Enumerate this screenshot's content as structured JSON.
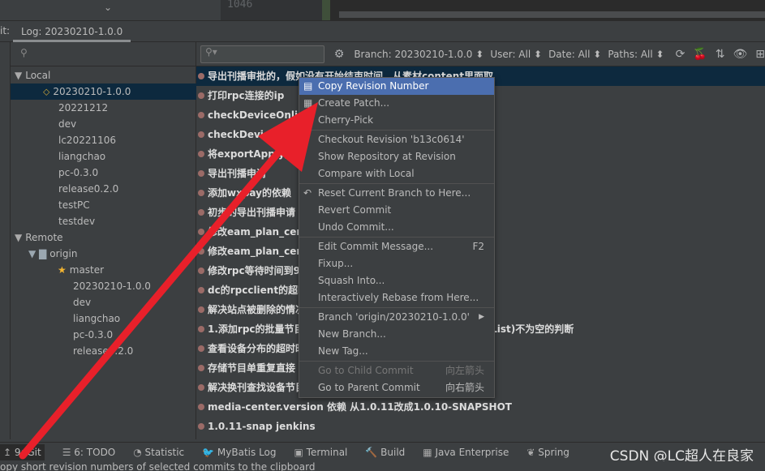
{
  "editor": {
    "line_number": "1046"
  },
  "tab": {
    "prefix": "it:",
    "label": "Log: 20230210-1.0.0"
  },
  "branches": {
    "local_label": "Local",
    "local": [
      "20230210-1.0.0",
      "20221212",
      "dev",
      "lc20221106",
      "liangchao",
      "pc-0.3.0",
      "release0.2.0",
      "testPC",
      "testdev"
    ],
    "remote_label": "Remote",
    "origin_label": "origin",
    "remote": [
      "master",
      "20230210-1.0.0",
      "dev",
      "liangchao",
      "pc-0.3.0",
      "release0.2.0"
    ]
  },
  "toolbar": {
    "branch": "Branch: 20230210-1.0.0 ⬍",
    "user": "User: All ⬍",
    "date": "Date: All ⬍",
    "paths": "Paths: All ⬍"
  },
  "commits": [
    "导出刊播审批的，假如没有开始结束时间，从素材content里面取",
    "打印rpc连接的ip",
    "checkDeviceOnline",
    "checkDeviceOnline",
    "将exportApply接口",
    "导出刊播申请",
    "添加wxpay的依赖",
    "初步的导出刊播申请",
    "修改eam_plan_cent",
    "修改eam_plan_cent",
    "修改rpc等待时间到9",
    "dc的rpcclient的超时",
    "解决站点被删除的情况",
    "1.添加rpc的批量节目 … 添加CollUtil.isNotEmpty(topInfoList)不为空的判断",
    "查看设备分布的超时时",
    "存储节目单重复直接",
    "解决换刊查找设备节目 … 判断了是否包含要替换的素材",
    "media-center.version 依赖 从1.0.11改成1.0.10-SNAPSHOT",
    "1.0.11-snap jenkins"
  ],
  "menu": {
    "groups": [
      [
        {
          "label": "Copy Revision Number",
          "icon": "copy-icon",
          "highlight": true
        },
        {
          "label": "Create Patch...",
          "icon": "patch-icon"
        },
        {
          "label": "Cherry-Pick"
        }
      ],
      [
        {
          "label": "Checkout Revision 'b13c0614'"
        },
        {
          "label": "Show Repository at Revision"
        },
        {
          "label": "Compare with Local"
        }
      ],
      [
        {
          "label": "Reset Current Branch to Here...",
          "icon": "undo-icon"
        },
        {
          "label": "Revert Commit"
        },
        {
          "label": "Undo Commit..."
        }
      ],
      [
        {
          "label": "Edit Commit Message...",
          "shortcut": "F2"
        },
        {
          "label": "Fixup..."
        },
        {
          "label": "Squash Into..."
        },
        {
          "label": "Interactively Rebase from Here..."
        }
      ],
      [
        {
          "label": "Branch 'origin/20230210-1.0.0'",
          "submenu": true
        },
        {
          "label": "New Branch..."
        },
        {
          "label": "New Tag..."
        }
      ],
      [
        {
          "label": "Go to Child Commit",
          "shortcut": "向左箭头",
          "disabled": true
        },
        {
          "label": "Go to Parent Commit",
          "shortcut": "向右箭头"
        }
      ]
    ]
  },
  "toolwindows": [
    {
      "label": "9: Git",
      "icon": "git-icon",
      "active": true
    },
    {
      "label": "6: TODO",
      "icon": "todo-icon"
    },
    {
      "label": "Statistic",
      "icon": "statistic-icon"
    },
    {
      "label": "MyBatis Log",
      "icon": "mybatis-icon"
    },
    {
      "label": "Terminal",
      "icon": "terminal-icon"
    },
    {
      "label": "Build",
      "icon": "build-icon"
    },
    {
      "label": "Java Enterprise",
      "icon": "java-enterprise-icon"
    },
    {
      "label": "Spring",
      "icon": "spring-icon"
    }
  ],
  "status": "opy short revision numbers of selected commits to the clipboard",
  "watermark": "CSDN @LC超人在良家",
  "colors": {
    "selection": "#0d293e",
    "menu_highlight": "#4b6eaf",
    "arrow": "#e8202a",
    "graph": "#9b6b67"
  }
}
